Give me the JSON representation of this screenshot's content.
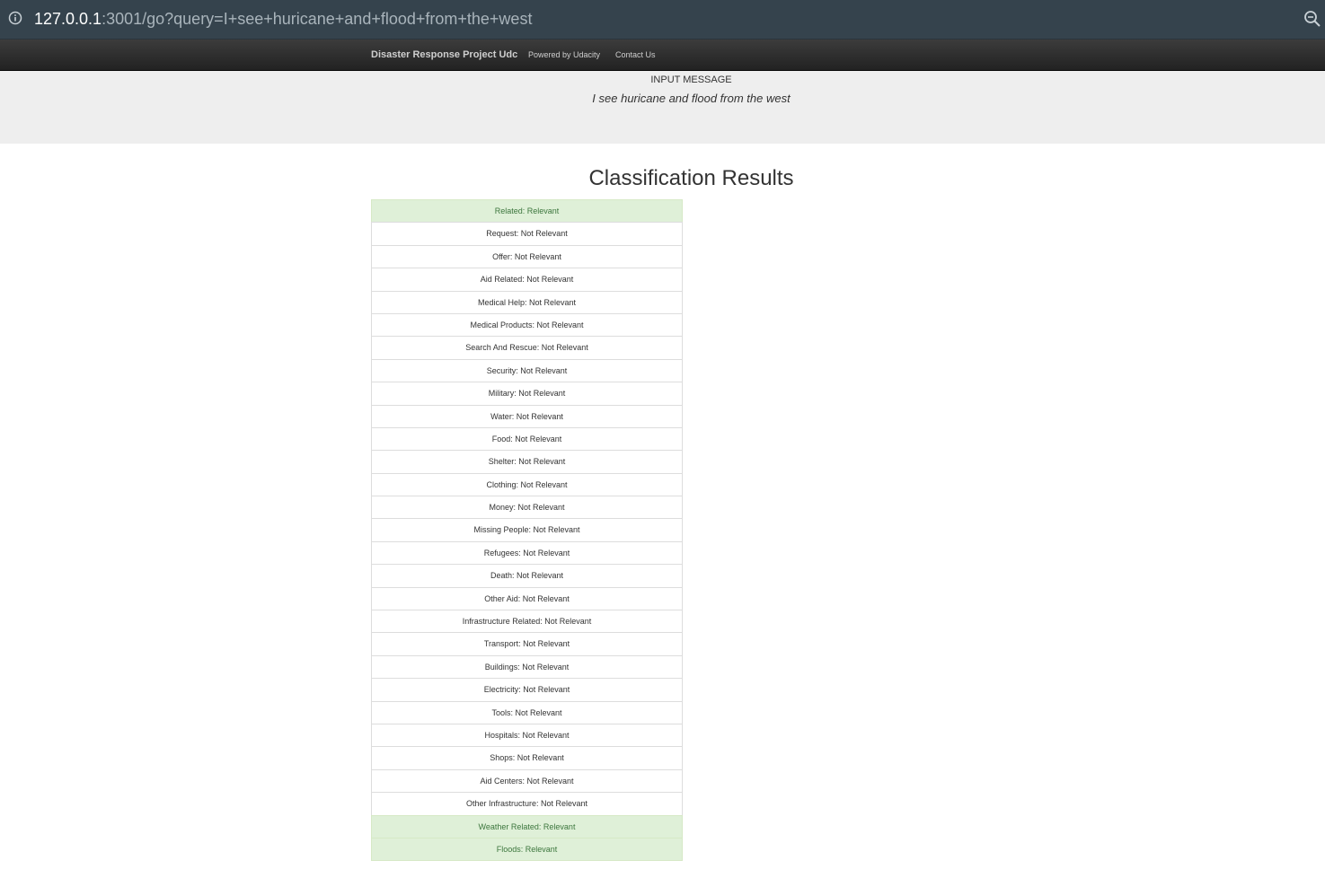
{
  "browser": {
    "url_host": "127.0.0.1",
    "url_rest": ":3001/go?query=I+see+huricane+and+flood+from+the+west"
  },
  "navbar": {
    "brand": "Disaster Response Project Udc",
    "links": [
      "Powered by Udacity",
      "Contact Us"
    ]
  },
  "jumbotron": {
    "label": "INPUT MESSAGE",
    "message": "I see huricane and flood from the west"
  },
  "results": {
    "title": "Classification Results",
    "items": [
      {
        "text": "Related: Relevant",
        "relevant": true
      },
      {
        "text": "Request: Not Relevant",
        "relevant": false
      },
      {
        "text": "Offer: Not Relevant",
        "relevant": false
      },
      {
        "text": "Aid Related: Not Relevant",
        "relevant": false
      },
      {
        "text": "Medical Help: Not Relevant",
        "relevant": false
      },
      {
        "text": "Medical Products: Not Relevant",
        "relevant": false
      },
      {
        "text": "Search And Rescue: Not Relevant",
        "relevant": false
      },
      {
        "text": "Security: Not Relevant",
        "relevant": false
      },
      {
        "text": "Military: Not Relevant",
        "relevant": false
      },
      {
        "text": "Water: Not Relevant",
        "relevant": false
      },
      {
        "text": "Food: Not Relevant",
        "relevant": false
      },
      {
        "text": "Shelter: Not Relevant",
        "relevant": false
      },
      {
        "text": "Clothing: Not Relevant",
        "relevant": false
      },
      {
        "text": "Money: Not Relevant",
        "relevant": false
      },
      {
        "text": "Missing People: Not Relevant",
        "relevant": false
      },
      {
        "text": "Refugees: Not Relevant",
        "relevant": false
      },
      {
        "text": "Death: Not Relevant",
        "relevant": false
      },
      {
        "text": "Other Aid: Not Relevant",
        "relevant": false
      },
      {
        "text": "Infrastructure Related: Not Relevant",
        "relevant": false
      },
      {
        "text": "Transport: Not Relevant",
        "relevant": false
      },
      {
        "text": "Buildings: Not Relevant",
        "relevant": false
      },
      {
        "text": "Electricity: Not Relevant",
        "relevant": false
      },
      {
        "text": "Tools: Not Relevant",
        "relevant": false
      },
      {
        "text": "Hospitals: Not Relevant",
        "relevant": false
      },
      {
        "text": "Shops: Not Relevant",
        "relevant": false
      },
      {
        "text": "Aid Centers: Not Relevant",
        "relevant": false
      },
      {
        "text": "Other Infrastructure: Not Relevant",
        "relevant": false
      },
      {
        "text": "Weather Related: Relevant",
        "relevant": true
      },
      {
        "text": "Floods: Relevant",
        "relevant": true
      }
    ]
  },
  "colors": {
    "relevant_bg": "#dff0d8",
    "relevant_text": "#3c763d",
    "navbar_bg": "#222222",
    "jumbotron_bg": "#eeeeee"
  }
}
